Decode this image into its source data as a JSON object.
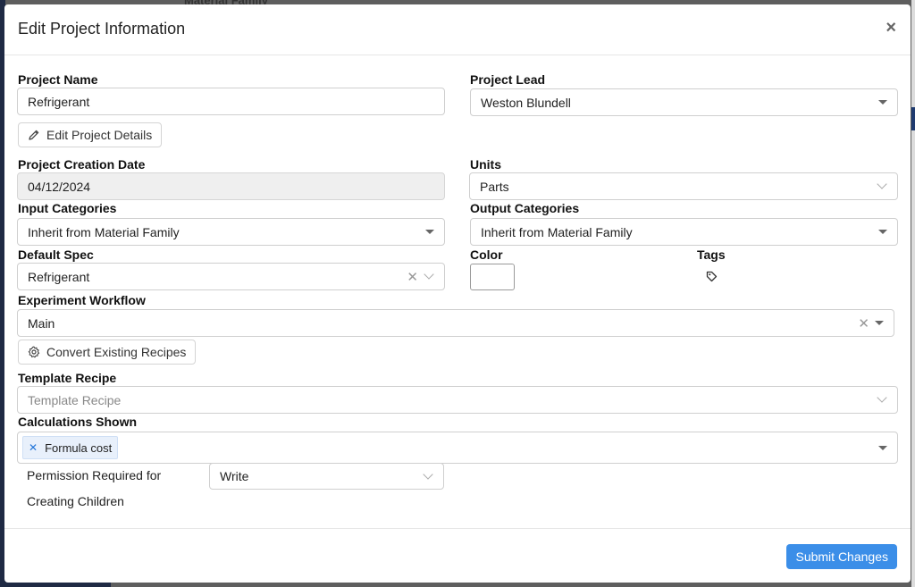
{
  "modal": {
    "title": "Edit Project Information",
    "close_label": "×"
  },
  "background": {
    "top_text": "Material Family"
  },
  "form": {
    "project_name": {
      "label": "Project Name",
      "value": "Refrigerant"
    },
    "project_lead": {
      "label": "Project Lead",
      "value": "Weston Blundell"
    },
    "edit_details_button": "Edit Project Details",
    "creation_date": {
      "label": "Project Creation Date",
      "value": "04/12/2024"
    },
    "units": {
      "label": "Units",
      "value": "Parts"
    },
    "input_categories": {
      "label": "Input Categories",
      "value": "Inherit from Material Family"
    },
    "output_categories": {
      "label": "Output Categories",
      "value": "Inherit from Material Family"
    },
    "default_spec": {
      "label": "Default Spec",
      "value": "Refrigerant"
    },
    "color": {
      "label": "Color",
      "value": "#ffffff"
    },
    "tags": {
      "label": "Tags"
    },
    "experiment_workflow": {
      "label": "Experiment Workflow",
      "value": "Main"
    },
    "convert_button": "Convert Existing Recipes",
    "template_recipe": {
      "label": "Template Recipe",
      "placeholder": "Template Recipe"
    },
    "calculations_shown": {
      "label": "Calculations Shown",
      "chips": [
        "Formula cost"
      ]
    },
    "permission": {
      "label_line1": "Permission Required for",
      "label_line2": "Creating Children",
      "value": "Write"
    }
  },
  "footer": {
    "submit_label": "Submit Changes"
  },
  "colors": {
    "primary": "#3b8ee8",
    "chip_bg": "#e8f0fb",
    "chip_x": "#1f73d8",
    "disabled_bg": "#efefef"
  },
  "icons": {
    "close": "close-icon",
    "pencil": "pencil-icon",
    "gear": "gear-icon",
    "tag": "tag-icon",
    "caret": "caret-down-icon",
    "chevron": "chevron-down-icon",
    "clear": "clear-icon"
  }
}
